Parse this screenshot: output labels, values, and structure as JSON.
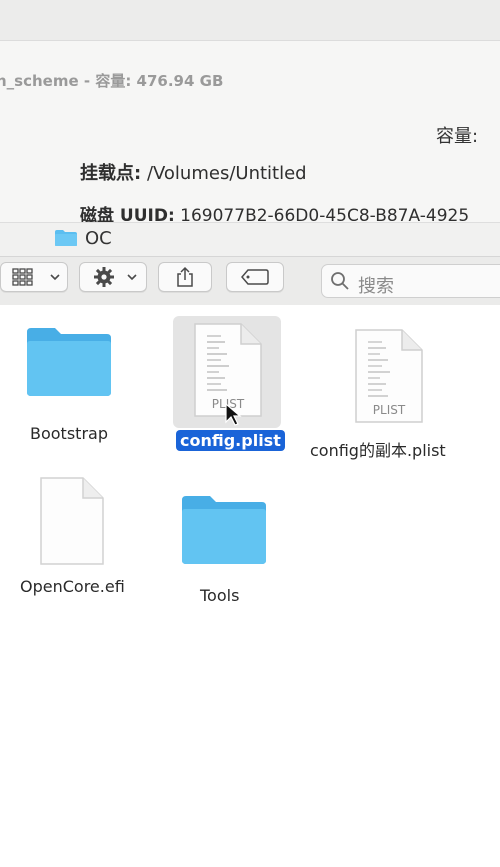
{
  "volume_header": {
    "title": "n_scheme - 容量: 476.94 GB",
    "capacity_label": "容量:",
    "mount_point_label": "挂载点:",
    "mount_point_value": "/Volumes/Untitled",
    "uuid_label": "磁盘 UUID:",
    "uuid_value": "169077B2-66D0-45C8-B87A-4925"
  },
  "path_bar": {
    "folder_icon": "folder-icon",
    "folder_name": "OC"
  },
  "toolbar": {
    "view_icon": "icon-grid-icon",
    "action_icon": "gear-icon",
    "share_icon": "share-icon",
    "tag_icon": "tag-icon",
    "search_placeholder": "搜索"
  },
  "files": [
    {
      "name": "Bootstrap",
      "kind": "folder"
    },
    {
      "name": "config.plist",
      "kind": "plist",
      "badge": "PLIST",
      "selected": true
    },
    {
      "name": "config的副本.plist",
      "kind": "plist",
      "badge": "PLIST"
    },
    {
      "name": "OpenCore.efi",
      "kind": "document"
    },
    {
      "name": "Tools",
      "kind": "folder"
    }
  ],
  "colors": {
    "folder_blue": "#5bbef0",
    "selection_blue": "#1a64d8"
  }
}
